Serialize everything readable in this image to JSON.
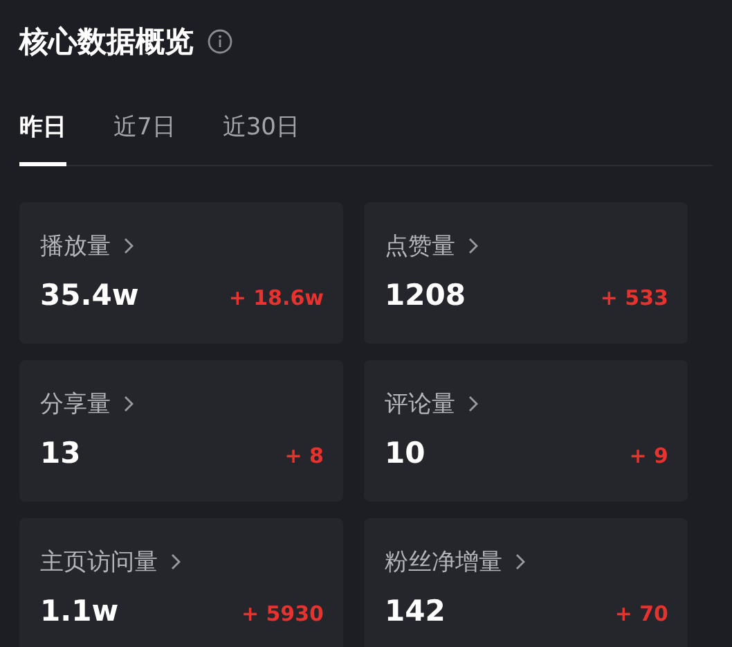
{
  "title": "核心数据概览",
  "tabs": [
    {
      "label": "昨日",
      "selected": true
    },
    {
      "label": "近7日",
      "selected": false
    },
    {
      "label": "近30日",
      "selected": false
    }
  ],
  "metrics": [
    {
      "name": "播放量",
      "value": "35.4w",
      "delta": "+ 18.6w"
    },
    {
      "name": "点赞量",
      "value": "1208",
      "delta": "+ 533"
    },
    {
      "name": "分享量",
      "value": "13",
      "delta": "+ 8"
    },
    {
      "name": "评论量",
      "value": "10",
      "delta": "+ 9"
    },
    {
      "name": "主页访问量",
      "value": "1.1w",
      "delta": "+ 5930"
    },
    {
      "name": "粉丝净增量",
      "value": "142",
      "delta": "+ 70"
    }
  ]
}
